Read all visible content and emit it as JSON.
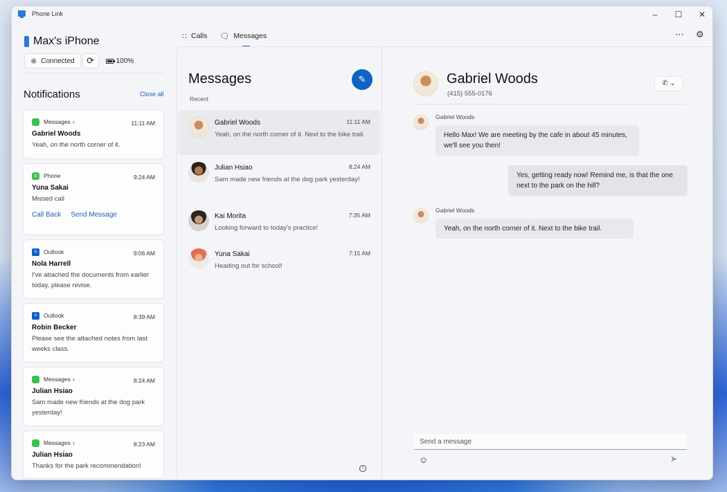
{
  "window": {
    "title": "Phone Link"
  },
  "device": {
    "name": "Max's iPhone",
    "connection": "Connected",
    "battery": "100%"
  },
  "notifications": {
    "heading": "Notifications",
    "close_all": "Close all",
    "items": [
      {
        "app": "Messages",
        "time": "11:11 AM",
        "sender": "Gabriel Woods",
        "body": "Yeah, on the north corner of it.",
        "icon": "messages-icon"
      },
      {
        "app": "Phone",
        "time": "9:24 AM",
        "sender": "Yuna Sakai",
        "body": "Missed call",
        "icon": "phone-icon",
        "actions": [
          "Call Back",
          "Send Message"
        ]
      },
      {
        "app": "Outlook",
        "time": "9:06 AM",
        "sender": "Nola Harrell",
        "body": "I've attached the documents from earlier today, please revise.",
        "icon": "outlook-icon"
      },
      {
        "app": "Outlook",
        "time": "8:39 AM",
        "sender": "Robin Becker",
        "body": "Please see the attached notes from last weeks class.",
        "icon": "outlook-icon"
      },
      {
        "app": "Messages",
        "time": "8:24 AM",
        "sender": "Julian Hsiao",
        "body": "Sam made new friends at the dog park yesterday!",
        "icon": "messages-icon"
      },
      {
        "app": "Messages",
        "time": "8:23 AM",
        "sender": "Julian Hsiao",
        "body": "Thanks for the park recommendation!",
        "icon": "messages-icon"
      }
    ]
  },
  "nav": {
    "tabs": [
      {
        "label": "Calls"
      },
      {
        "label": "Messages",
        "active": true
      }
    ]
  },
  "messages_panel": {
    "title": "Messages",
    "section": "Recent",
    "conversations": [
      {
        "name": "Gabriel Woods",
        "time": "11:11 AM",
        "preview": "Yeah, on the north corner of it. Next to the bike trail.",
        "active": true
      },
      {
        "name": "Julian Hsiao",
        "time": "8:24 AM",
        "preview": "Sam made new friends at the dog park yesterday!"
      },
      {
        "name": "Kai Morita",
        "time": "7:35 AM",
        "preview": "Looking forward to today's practice!"
      },
      {
        "name": "Yuna Sakai",
        "time": "7:15 AM",
        "preview": "Heading out for school!"
      }
    ]
  },
  "conversation": {
    "name": "Gabriel Woods",
    "phone": "(415) 555-0176",
    "messages": [
      {
        "sender": "Gabriel Woods",
        "text": "Hello Max! We are meeting by the cafe in about 45 minutes, we'll see you then!",
        "direction": "in"
      },
      {
        "text": "Yes, getting ready now! Remind me, is that the one next to the park on the hill?",
        "direction": "out"
      },
      {
        "sender": "Gabriel Woods",
        "text": "Yeah, on the north corner of it. Next to the bike trail.",
        "direction": "in"
      }
    ],
    "input_placeholder": "Send a message"
  },
  "colors": {
    "accent": "#0f64c2",
    "link": "#1f5fb5",
    "messages_app": "#3dbf4f"
  }
}
